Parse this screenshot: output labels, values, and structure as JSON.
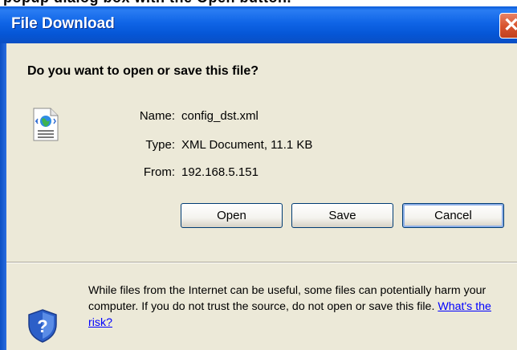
{
  "window": {
    "title": "File Download",
    "close_symbol": "✕"
  },
  "dialog": {
    "question": "Do you want to open or save this file?",
    "file_icon": "xml-document-icon",
    "fields": {
      "name_label": "Name:",
      "name_value": "config_dst.xml",
      "type_label": "Type:",
      "type_value": "XML Document, 11.1 KB",
      "from_label": "From:",
      "from_value": "192.168.5.151"
    },
    "buttons": {
      "open_label": "Open",
      "save_label": "Save",
      "cancel_label": "Cancel"
    }
  },
  "warning": {
    "icon": "security-shield-question-icon",
    "text": "While files from the Internet can be useful, some files can potentially harm your computer. If you do not trust the source, do not open or save this file.",
    "link_text": "What's the risk?"
  },
  "colors": {
    "titlebar_blue": "#0556d6",
    "dialog_background": "#ece9d8",
    "close_button_red": "#d9552f",
    "link_blue": "#0000ff"
  }
}
